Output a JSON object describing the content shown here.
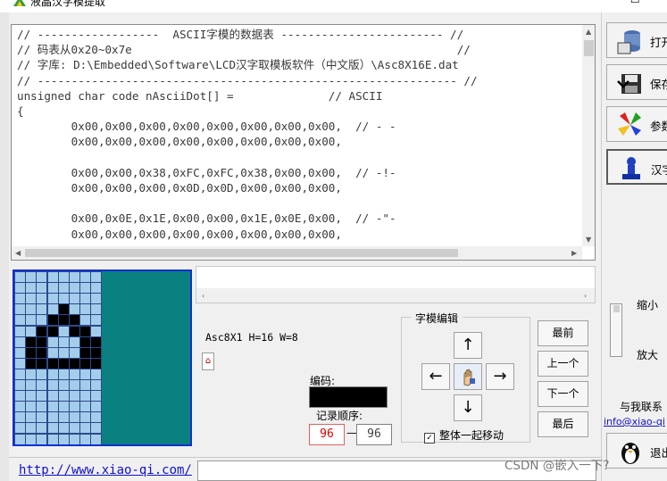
{
  "window": {
    "title": "液晶汉字模提取",
    "controls": "—   ☐"
  },
  "code": {
    "lines": [
      "// ------------------  ASCII字模的数据表 ------------------------ //",
      "// 码表从0x20~0x7e                                                //",
      "// 字库: D:\\Embedded\\Software\\LCD汉字取模板软件（中文版）\\Asc8X16E.dat",
      "// -------------------------------------------------------------- //",
      "unsigned char code nAsciiDot[] =              // ASCII",
      "{",
      "        0x00,0x00,0x00,0x00,0x00,0x00,0x00,0x00,  // - -",
      "        0x00,0x00,0x00,0x00,0x00,0x00,0x00,0x00,",
      "",
      "        0x00,0x00,0x38,0xFC,0xFC,0x38,0x00,0x00,  // -!-",
      "        0x00,0x00,0x00,0x0D,0x0D,0x00,0x00,0x00,",
      "",
      "        0x00,0x0E,0x1E,0x00,0x00,0x1E,0x0E,0x00,  // -\"-",
      "        0x00,0x00,0x00,0x00,0x00,0x00,0x00,0x00,"
    ]
  },
  "glyph_grid": {
    "cols": 8,
    "rows": 16,
    "on_cells": [
      [
        4,
        3
      ],
      [
        3,
        4
      ],
      [
        4,
        4
      ],
      [
        5,
        4
      ],
      [
        2,
        5
      ],
      [
        3,
        5
      ],
      [
        5,
        5
      ],
      [
        6,
        5
      ],
      [
        1,
        6
      ],
      [
        2,
        6
      ],
      [
        6,
        6
      ],
      [
        7,
        6
      ],
      [
        1,
        7
      ],
      [
        2,
        7
      ],
      [
        6,
        7
      ],
      [
        7,
        7
      ],
      [
        1,
        8
      ],
      [
        2,
        8
      ],
      [
        3,
        8
      ],
      [
        4,
        8
      ],
      [
        5,
        8
      ],
      [
        6,
        8
      ],
      [
        7,
        8
      ]
    ]
  },
  "info": {
    "font_info": "Asc8X1 H=16 W=8",
    "small_glyph": "⌂",
    "code_label": "编码:",
    "order_label": "记录顺序:",
    "order_start": "96",
    "order_sep": "—",
    "order_end": "96"
  },
  "edit_panel": {
    "title": "字模编辑",
    "up": "↑",
    "left": "←",
    "right": "→",
    "down": "↓",
    "move_together": "整体一起移动",
    "check_mark": "✓"
  },
  "nav": {
    "first": "最前",
    "prev": "上一个",
    "next": "下一个",
    "last": "最后"
  },
  "right_panel": {
    "open": "打开",
    "save": "保存",
    "params": "参数",
    "chars": "汉字",
    "zoom_small": "缩小",
    "zoom_large": "放大",
    "contact": "与我联系",
    "email": "info@xiao-qi",
    "exit": "退出"
  },
  "footer": {
    "website": "http://www.xiao-qi.com/",
    "watermark": "CSDN @嵌入一下？"
  },
  "colors": {
    "grid_off": "#a4cdec",
    "grid_on": "#000000",
    "grid_side": "#0a8080",
    "grid_border": "#1030d0",
    "link": "#1010d0",
    "order_red": "#e00000"
  }
}
